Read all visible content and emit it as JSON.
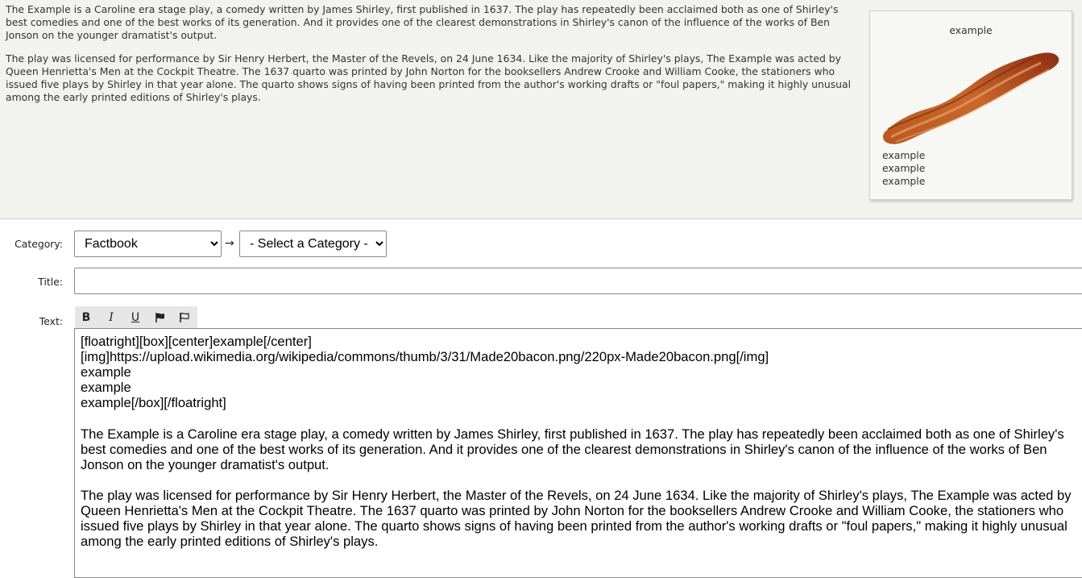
{
  "preview": {
    "paragraphs": [
      "The Example is a Caroline era stage play, a comedy written by James Shirley, first published in 1637. The play has repeatedly been acclaimed both as one of Shirley's best comedies and one of the best works of its generation. And it provides one of the clearest demonstrations in Shirley's canon of the influence of the works of Ben Jonson on the younger dramatist's output.",
      "The play was licensed for performance by Sir Henry Herbert, the Master of the Revels, on 24 June 1634. Like the majority of Shirley's plays, The Example was acted by Queen Henrietta's Men at the Cockpit Theatre. The 1637 quarto was printed by John Norton for the booksellers Andrew Crooke and William Cooke, the stationers who issued five plays by Shirley in that year alone. The quarto shows signs of having been printed from the author's working drafts or \"foul papers,\" making it highly unusual among the early printed editions of Shirley's plays."
    ],
    "box": {
      "title": "example",
      "image_icon": "bacon-image",
      "lines": [
        "example",
        "example",
        "example"
      ]
    }
  },
  "form": {
    "category_label": "Category:",
    "category_value": "Factbook",
    "arrow": "→",
    "subcategory_value": "- Select a Category -",
    "title_label": "Title:",
    "title_value": "",
    "text_label": "Text:",
    "toolbar": {
      "bold": "B",
      "italic": "I",
      "underline": "U",
      "flag_icon": "flag-filled-icon",
      "flag_outline_icon": "flag-outline-icon"
    },
    "text_value": "[floatright][box][center]example[/center]\n[img]https://upload.wikimedia.org/wikipedia/commons/thumb/3/31/Made20bacon.png/220px-Made20bacon.png[/img]\nexample\nexample\nexample[/box][/floatright]\n\nThe Example is a Caroline era stage play, a comedy written by James Shirley, first published in 1637. The play has repeatedly been acclaimed both as one of Shirley's best comedies and one of the best works of its generation. And it provides one of the clearest demonstrations in Shirley's canon of the influence of the works of Ben Jonson on the younger dramatist's output.\n\nThe play was licensed for performance by Sir Henry Herbert, the Master of the Revels, on 24 June 1634. Like the majority of Shirley's plays, The Example was acted by Queen Henrietta's Men at the Cockpit Theatre. The 1637 quarto was printed by John Norton for the booksellers Andrew Crooke and William Cooke, the stationers who issued five plays by Shirley in that year alone. The quarto shows signs of having been printed from the author's working drafts or \"foul papers,\" making it highly unusual among the early printed editions of Shirley's plays."
  },
  "colors": {
    "preview_background": "#f2f2ee",
    "toolbar_background": "#e6e6e6"
  }
}
